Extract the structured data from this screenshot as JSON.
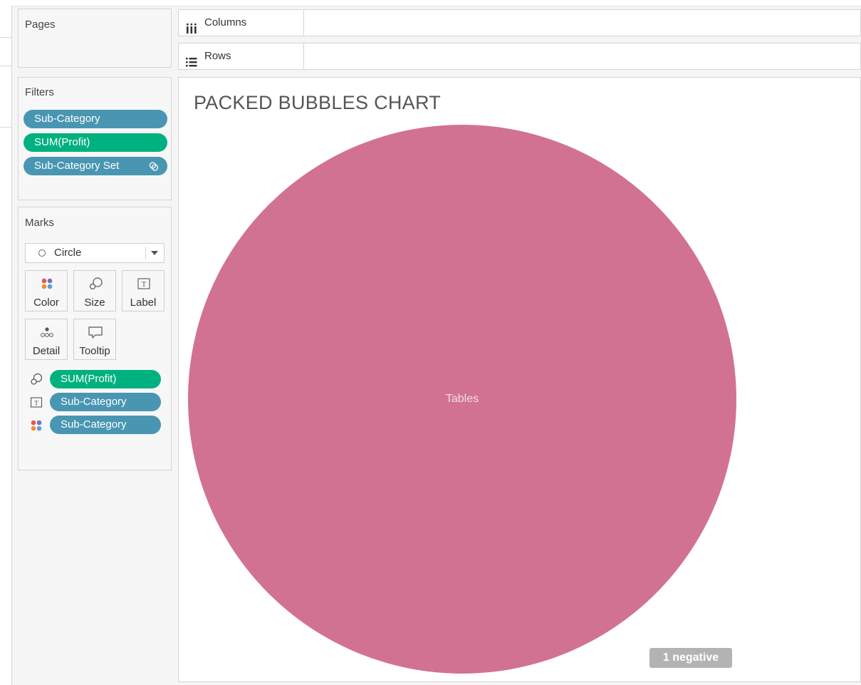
{
  "pages_panel": {
    "title": "Pages"
  },
  "filters_panel": {
    "title": "Filters",
    "pills": [
      {
        "label": "Sub-Category",
        "color": "#4996b2"
      },
      {
        "label": "SUM(Profit)",
        "color": "#00b180"
      },
      {
        "label": "Sub-Category Set",
        "color": "#4996b2",
        "icon": "set-icon"
      }
    ]
  },
  "marks_panel": {
    "title": "Marks",
    "mark_type": {
      "label": "Circle",
      "icon": "circle-icon"
    },
    "buttons": [
      {
        "label": "Color",
        "icon": "color-dots-icon"
      },
      {
        "label": "Size",
        "icon": "size-icon"
      },
      {
        "label": "Label",
        "icon": "text-label-icon"
      },
      {
        "label": "Detail",
        "icon": "detail-dots-icon"
      },
      {
        "label": "Tooltip",
        "icon": "tooltip-icon"
      }
    ],
    "encodings": [
      {
        "icon": "size-icon",
        "label": "SUM(Profit)",
        "color": "#00b180"
      },
      {
        "icon": "text-label-icon",
        "label": "Sub-Category",
        "color": "#4996b2"
      },
      {
        "icon": "color-dots-icon",
        "label": "Sub-Category",
        "color": "#4996b2"
      }
    ]
  },
  "shelves": {
    "columns": {
      "label": "Columns",
      "icon": "columns-icon"
    },
    "rows": {
      "label": "Rows",
      "icon": "rows-icon"
    }
  },
  "viz": {
    "title": "PACKED BUBBLES CHART",
    "negative_badge": "1 negative"
  },
  "chart_data": {
    "type": "bubble",
    "title": "PACKED BUBBLES CHART",
    "bubbles": [
      {
        "label": "Tables",
        "color": "#d27293"
      }
    ],
    "note": "1 negative"
  }
}
